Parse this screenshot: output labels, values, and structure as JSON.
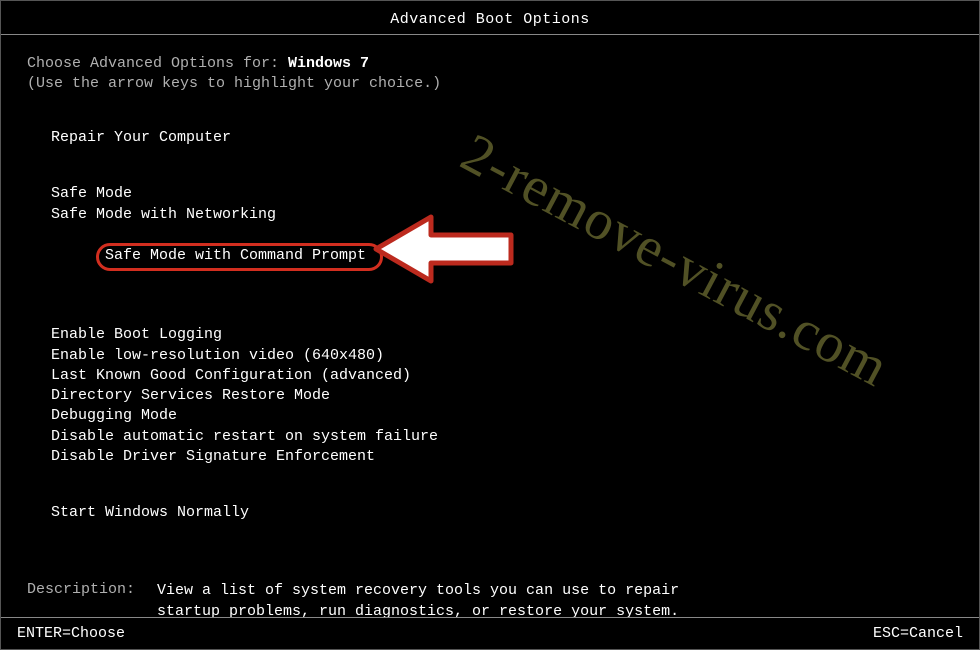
{
  "title": "Advanced Boot Options",
  "prompt_prefix": "Choose Advanced Options for: ",
  "os_name": "Windows 7",
  "hint": "(Use the arrow keys to highlight your choice.)",
  "menu": {
    "group0": [
      "Repair Your Computer"
    ],
    "group1": [
      "Safe Mode",
      "Safe Mode with Networking",
      "Safe Mode with Command Prompt"
    ],
    "group2": [
      "Enable Boot Logging",
      "Enable low-resolution video (640x480)",
      "Last Known Good Configuration (advanced)",
      "Directory Services Restore Mode",
      "Debugging Mode",
      "Disable automatic restart on system failure",
      "Disable Driver Signature Enforcement"
    ],
    "group3": [
      "Start Windows Normally"
    ]
  },
  "highlighted_item": "Safe Mode with Command Prompt",
  "description": {
    "label": "Description:",
    "text_line1": "View a list of system recovery tools you can use to repair",
    "text_line2": "startup problems, run diagnostics, or restore your system."
  },
  "footer": {
    "left": "ENTER=Choose",
    "right": "ESC=Cancel"
  },
  "watermark": "2-remove-virus.com",
  "colors": {
    "highlight_ring": "#d22e1f",
    "text_bright": "#ffffff",
    "text_dim": "#b0b0b0",
    "watermark": "#5a5a2a"
  }
}
